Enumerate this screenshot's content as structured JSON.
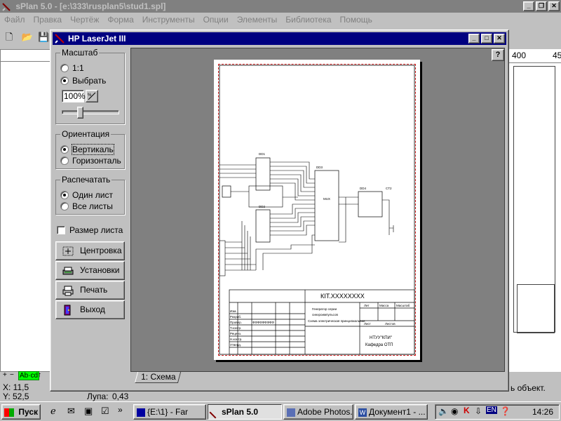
{
  "app": {
    "title": "sPlan 5.0 - [e:\\333\\rusplan5\\stud1.spl]",
    "menu": [
      "Файл",
      "Правка",
      "Чертёж",
      "Форма",
      "Инструменты",
      "Опции",
      "Элементы",
      "Библиотека",
      "Помощь"
    ],
    "ruler_labels": [
      "400",
      "45"
    ],
    "status": {
      "x": "X: 11,5",
      "y": "Y: 52,5",
      "zoom_label": "Лупа:",
      "zoom_value": "0,43",
      "hint": "ь объект.",
      "layer_tab": "Ab·cd"
    }
  },
  "dialog": {
    "title": "HP LaserJet III",
    "help": "?",
    "scale": {
      "title": "Масштаб",
      "opt_1to1": "1:1",
      "opt_choose": "Выбрать",
      "selected": "choose",
      "percent": "100%"
    },
    "orientation": {
      "title": "Ориентация",
      "portrait": "Вертикаль",
      "landscape": "Горизонталь",
      "selected": "portrait"
    },
    "print_range": {
      "title": "Распечатать",
      "one_sheet": "Один лист",
      "all_sheets": "Все листы",
      "selected": "one_sheet"
    },
    "sheet_size_label": "Размер листа",
    "sheet_size_checked": false,
    "buttons": {
      "center": "Центровка",
      "settings": "Установки",
      "print": "Печать",
      "exit": "Выход"
    },
    "sheet_tab": "1: Схема",
    "preview": {
      "doc_code": "КIТ.ХХХХХХХХ",
      "title_line1": "Генератор серии",
      "title_line2": "синхроимпульсов",
      "title_line3": "Схема электрическая принципиальная",
      "org_line1": "НТУУ\"КПИ\"",
      "org_line2": "Кафедра ОТП",
      "stamp_left": [
        "Изм.",
        "Разраб.",
        "Провер.",
        "Т.контр.",
        "Реценз.",
        "Н.контр.",
        "Утверд."
      ],
      "stamp_cols": [
        "Лит",
        "Масса",
        "Масштаб"
      ],
      "sheet_row": [
        "Лист",
        "Листов"
      ],
      "name_placeholder": "ФФФФФФФФФ",
      "chip_labels": [
        "DD1",
        "DD2",
        "DD3",
        "DD4",
        "MUX",
        "CT2"
      ]
    }
  },
  "taskbar": {
    "start": "Пуск",
    "tasks": [
      "{E:\\1} - Far",
      "sPlan 5.0",
      "Adobe Photos...",
      "Документ1 - ..."
    ],
    "active_index": 1,
    "clock": "14:26",
    "lang": "EN"
  }
}
